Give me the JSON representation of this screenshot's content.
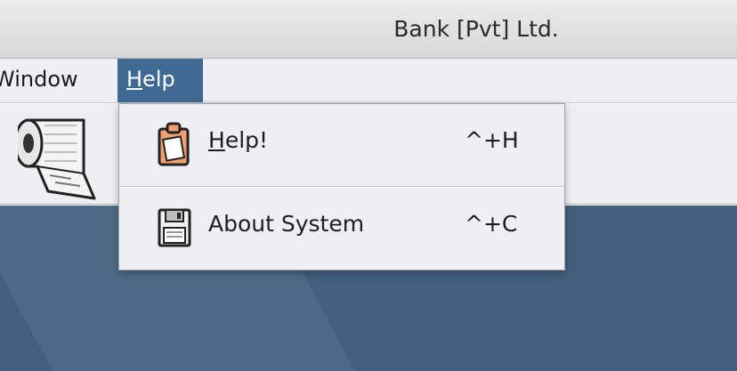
{
  "window": {
    "title": "Bank [Pvt] Ltd."
  },
  "menubar": {
    "window_label": "Window",
    "help_label_mnemonic": "H",
    "help_label_rest": "elp"
  },
  "toolbar": {
    "icons": [
      "toilet-paper-icon"
    ]
  },
  "help_menu": {
    "items": [
      {
        "label_mnemonic": "H",
        "label_rest": "elp!",
        "shortcut": "^+H",
        "icon": "clipboard-icon"
      },
      {
        "label": "About System",
        "shortcut": "^+C",
        "icon": "floppy-disk-icon"
      }
    ]
  },
  "colors": {
    "menu_highlight": "#3f6a93",
    "desktop": "#445f7d",
    "menu_background": "#eeeef3"
  }
}
